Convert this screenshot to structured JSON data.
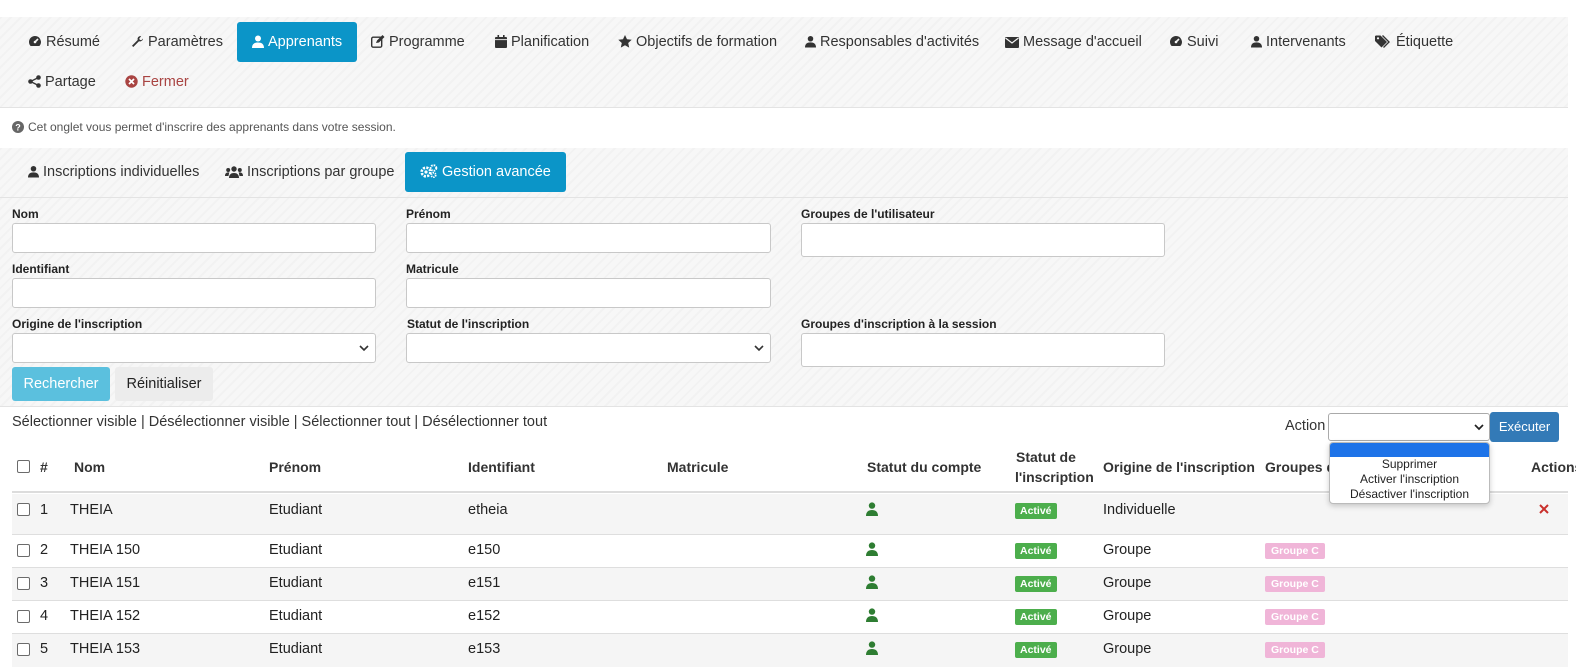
{
  "nav": {
    "tabs": [
      {
        "label": "Résumé",
        "icon": "dashboard-icon"
      },
      {
        "label": "Paramètres",
        "icon": "wrench-icon"
      },
      {
        "label": "Apprenants",
        "icon": "user-icon",
        "active": true
      },
      {
        "label": "Programme",
        "icon": "edit-icon"
      },
      {
        "label": "Planification",
        "icon": "calendar-icon"
      },
      {
        "label": "Objectifs de formation",
        "icon": "star-icon"
      },
      {
        "label": "Responsables d'activités",
        "icon": "user-icon"
      },
      {
        "label": "Message d'accueil",
        "icon": "envelope-icon"
      },
      {
        "label": "Suivi",
        "icon": "dashboard-icon"
      },
      {
        "label": "Intervenants",
        "icon": "user-icon"
      },
      {
        "label": "Étiquette",
        "icon": "tags-icon"
      },
      {
        "label": "Partage",
        "icon": "share-icon"
      },
      {
        "label": "Fermer",
        "icon": "close-circle-icon"
      }
    ]
  },
  "info_text": "Cet onglet vous permet d'inscrire des apprenants dans votre session.",
  "subtabs": [
    {
      "label": "Inscriptions individuelles",
      "icon": "user-icon"
    },
    {
      "label": "Inscriptions par groupe",
      "icon": "users-icon"
    },
    {
      "label": "Gestion avancée",
      "icon": "cogs-icon",
      "active": true
    }
  ],
  "filters": {
    "nom": {
      "label": "Nom",
      "value": ""
    },
    "prenom": {
      "label": "Prénom",
      "value": ""
    },
    "groupes_utilisateur": {
      "label": "Groupes de l'utilisateur",
      "value": ""
    },
    "identifiant": {
      "label": "Identifiant",
      "value": ""
    },
    "matricule": {
      "label": "Matricule",
      "value": ""
    },
    "origine": {
      "label": "Origine de l'inscription",
      "value": ""
    },
    "statut": {
      "label": "Statut de l'inscription",
      "value": ""
    },
    "groupes_session": {
      "label": "Groupes d'inscription à la session",
      "value": ""
    },
    "search_label": "Rechercher",
    "reset_label": "Réinitialiser"
  },
  "selection_links": [
    "Sélectionner visible",
    "Désélectionner visible",
    "Sélectionner tout",
    "Désélectionner tout"
  ],
  "selection_separator": "|",
  "action": {
    "label": "Action",
    "selected": "",
    "execute_label": "Exécuter",
    "options": [
      "",
      "Supprimer",
      "Activer l'inscription",
      "Désactiver l'inscription"
    ]
  },
  "table": {
    "headers": {
      "num": "#",
      "nom": "Nom",
      "prenom": "Prénom",
      "identifiant": "Identifiant",
      "matricule": "Matricule",
      "statut_compte": "Statut du compte",
      "statut_inscription_1": "Statut de",
      "statut_inscription_2": "l'inscription",
      "origine": "Origine de l'inscription",
      "groupes": "Groupes d",
      "actions": "Actions"
    },
    "rows": [
      {
        "num": "1",
        "nom": "THEIA",
        "prenom": "Etudiant",
        "identifiant": "etheia",
        "matricule": "",
        "statut": "Activé",
        "origine": "Individuelle",
        "groupe": ""
      },
      {
        "num": "2",
        "nom": "THEIA 150",
        "prenom": "Etudiant",
        "identifiant": "e150",
        "matricule": "",
        "statut": "Activé",
        "origine": "Groupe",
        "groupe": "Groupe C"
      },
      {
        "num": "3",
        "nom": "THEIA 151",
        "prenom": "Etudiant",
        "identifiant": "e151",
        "matricule": "",
        "statut": "Activé",
        "origine": "Groupe",
        "groupe": "Groupe C"
      },
      {
        "num": "4",
        "nom": "THEIA 152",
        "prenom": "Etudiant",
        "identifiant": "e152",
        "matricule": "",
        "statut": "Activé",
        "origine": "Groupe",
        "groupe": "Groupe C"
      },
      {
        "num": "5",
        "nom": "THEIA 153",
        "prenom": "Etudiant",
        "identifiant": "e153",
        "matricule": "",
        "statut": "Activé",
        "origine": "Groupe",
        "groupe": "Groupe C"
      }
    ],
    "delete_icon": "close-icon"
  },
  "colors": {
    "active_tab": "#0b95c8",
    "search_button": "#5bc0de",
    "execute_button": "#337ab7",
    "badge_active": "#4cae4c",
    "badge_group": "#f0b5d8",
    "delete_red": "#c9302c",
    "close_red": "#a94442",
    "account_icon": "#2e7d32"
  }
}
